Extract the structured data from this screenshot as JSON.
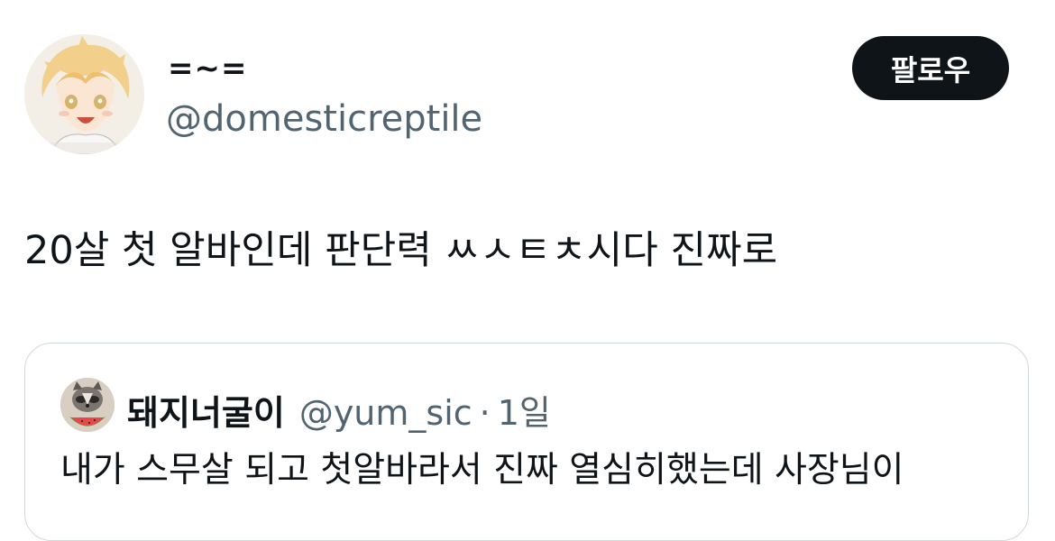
{
  "author": {
    "display_name": "=~=",
    "handle": "@domesticreptile",
    "avatar_icon": "anime-avatar-icon"
  },
  "follow_button": {
    "label": "팔로우",
    "bg_color": "#0f1419",
    "text_color": "#ffffff"
  },
  "tweet": {
    "text": "20살 첫 알바인데 판단력 ㅆㅅㅌㅊ시다 진짜로"
  },
  "quoted_tweet": {
    "display_name": "돼지너굴이",
    "handle": "@yum_sic",
    "separator": "·",
    "time": "1일",
    "avatar_icon": "raccoon-avatar-icon",
    "text": "내가 스무살 되고 첫알바라서 진짜 열심히했는데 사장님이"
  },
  "colors": {
    "primary_text": "#0f1419",
    "secondary_text": "#536471",
    "border": "#cfd9de"
  }
}
